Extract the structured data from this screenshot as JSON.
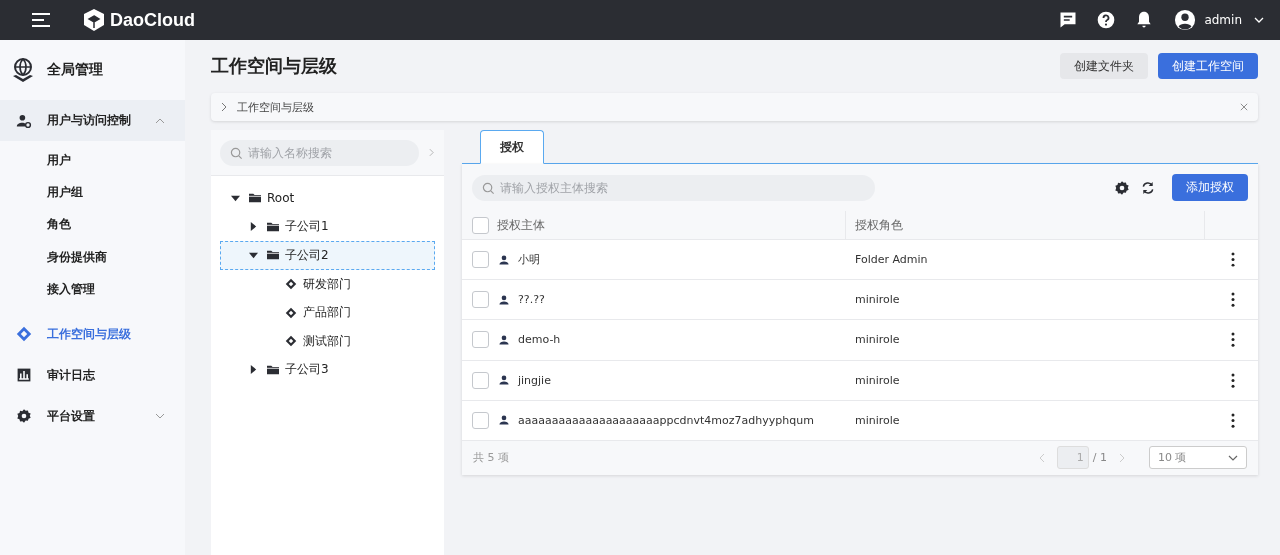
{
  "topbar": {
    "logo": "DaoCloud",
    "user": "admin"
  },
  "sidebar": {
    "title": "全局管理",
    "items": [
      {
        "label": "用户与访问控制",
        "expanded": true,
        "selected": false,
        "children": [
          {
            "label": "用户"
          },
          {
            "label": "用户组"
          },
          {
            "label": "角色"
          },
          {
            "label": "身份提供商"
          },
          {
            "label": "接入管理"
          }
        ]
      },
      {
        "label": "工作空间与层级",
        "selected": true
      },
      {
        "label": "审计日志",
        "selected": false
      },
      {
        "label": "平台设置",
        "expanded": false,
        "selected": false
      }
    ]
  },
  "page": {
    "title": "工作空间与层级",
    "buttons": [
      {
        "label": "创建文件夹",
        "kind": "secondary"
      },
      {
        "label": "创建工作空间",
        "kind": "primary"
      }
    ],
    "breadcrumb": "工作空间与层级"
  },
  "tree": {
    "search_placeholder": "请输入名称搜索",
    "nodes": [
      {
        "label": "Root",
        "kind": "folder",
        "expanded": true,
        "selected": false,
        "children": [
          {
            "label": "子公司1",
            "kind": "folder",
            "expanded": false,
            "selected": false
          },
          {
            "label": "子公司2",
            "kind": "folder",
            "expanded": true,
            "selected": true,
            "children": [
              {
                "label": "研发部门",
                "kind": "workspace",
                "selected": false
              },
              {
                "label": "产品部门",
                "kind": "workspace",
                "selected": false
              },
              {
                "label": "测试部门",
                "kind": "workspace",
                "selected": false
              }
            ]
          },
          {
            "label": "子公司3",
            "kind": "folder",
            "expanded": false,
            "selected": false
          }
        ]
      }
    ]
  },
  "tabs": [
    {
      "label": "授权",
      "selected": true
    }
  ],
  "table": {
    "all_checked": false,
    "search_placeholder": "请输入授权主体搜索",
    "add_button": "添加授权",
    "columns": [
      "授权主体",
      "授权角色"
    ],
    "rows": [
      {
        "subject": "小明",
        "role": "Folder Admin",
        "checked": false
      },
      {
        "subject": "??.??",
        "role": "minirole",
        "checked": false
      },
      {
        "subject": "demo-h",
        "role": "minirole",
        "checked": false
      },
      {
        "subject": "jingjie",
        "role": "minirole",
        "checked": false
      },
      {
        "subject": "aaaaaaaaaaaaaaaaaaaaappcdnvt4moz7adhyyphqum",
        "role": "minirole",
        "checked": false
      }
    ],
    "total": "共 5 项",
    "page": "1",
    "pages": "/ 1",
    "page_size": "10 项"
  }
}
